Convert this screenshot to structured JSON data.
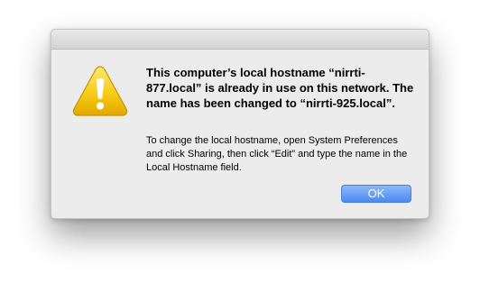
{
  "alert": {
    "heading": "This computer’s local hostname “nirrti-877.local” is already in use on this network. The name has been changed to “nirrti-925.local”.",
    "body": "To change the local hostname, open System Preferences and click Sharing, then click “Edit” and type the name in the Local Hostname field.",
    "icon": "warning-icon",
    "ok_label": "OK"
  },
  "colors": {
    "accent": "#4a8af1",
    "warning": "#f2c200",
    "window_bg": "#ececec"
  }
}
